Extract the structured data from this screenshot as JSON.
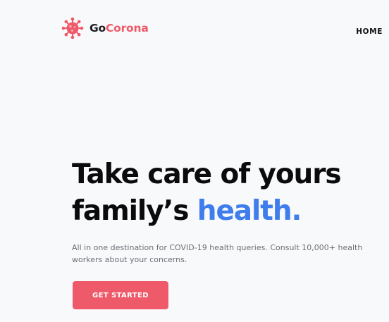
{
  "brand": {
    "name_prefix": "Go",
    "name_suffix": "Corona",
    "logo_icon": "virus-icon",
    "colors": {
      "accent": "#ef5a6a",
      "highlight": "#3f7cec",
      "text": "#0b0b0d"
    }
  },
  "nav": {
    "items": [
      {
        "label": "HOME"
      }
    ]
  },
  "hero": {
    "title_line1": "Take care of yours",
    "title_line2_prefix": "family’s ",
    "title_line2_accent": "health.",
    "description": "All in one destination for COVID-19 health queries. Consult 10,000+ health workers about your concerns.",
    "cta_label": "GET STARTED"
  }
}
